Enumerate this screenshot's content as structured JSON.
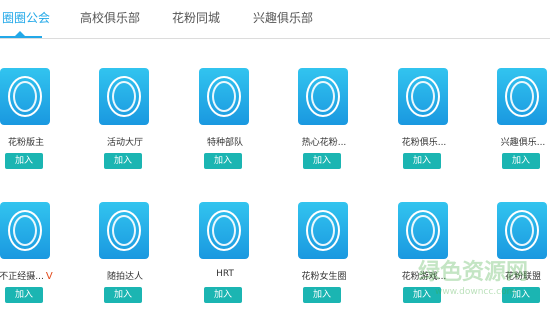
{
  "tabs": [
    {
      "label": "圈圈公会",
      "active": true
    },
    {
      "label": "高校俱乐部",
      "active": false
    },
    {
      "label": "花粉同城",
      "active": false
    },
    {
      "label": "兴趣俱乐部",
      "active": false
    }
  ],
  "join_label": "加入",
  "groups": [
    {
      "name": "花粉版主"
    },
    {
      "name": "活动大厅"
    },
    {
      "name": "特种部队"
    },
    {
      "name": "热心花粉..."
    },
    {
      "name": "花粉俱乐..."
    },
    {
      "name": "兴趣俱乐..."
    },
    {
      "name": "不正经摄...",
      "mark": "V"
    },
    {
      "name": "随拍达人"
    },
    {
      "name": "HRT"
    },
    {
      "name": "花粉女生圈"
    },
    {
      "name": "花粉游戏..."
    },
    {
      "name": "花粉联盟"
    }
  ],
  "watermark": {
    "text": "绿色资源网",
    "url": "www.downcc.com"
  },
  "colors": {
    "accent": "#22a8e8",
    "join_button": "#1bb5b2",
    "icon_top": "#32c4ef",
    "icon_bottom": "#1a98e0"
  }
}
